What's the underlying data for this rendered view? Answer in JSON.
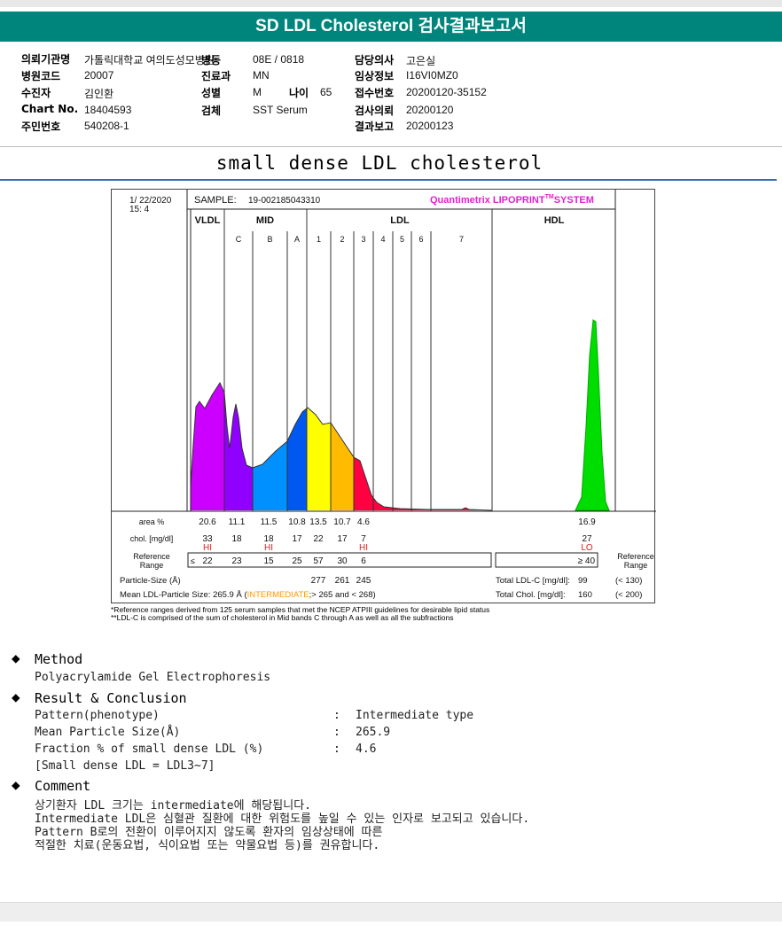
{
  "title": "SD LDL Cholesterol 검사결과보고서",
  "info": [
    {
      "label": "의뢰기관명",
      "value": "가톨릭대학교 여의도성모병원"
    },
    {
      "label": "병동",
      "value": "08E / 0818"
    },
    {
      "label": "담당의사",
      "value": "고은실"
    },
    {
      "label": "병원코드",
      "value": "20007"
    },
    {
      "label": "진료과",
      "value": "MN"
    },
    {
      "label": "임상정보",
      "value": "I16VI0MZ0"
    },
    {
      "label": "수진자",
      "value": "김인환"
    },
    {
      "label": "성별",
      "value": "M"
    },
    {
      "label": "나이",
      "value": "65"
    },
    {
      "label": "접수번호",
      "value": "20200120-35152"
    },
    {
      "label": "Chart No.",
      "value": "18404593"
    },
    {
      "label": "검체",
      "value": "SST Serum"
    },
    {
      "label": "검사의뢰",
      "value": "20200120"
    },
    {
      "label": "주민번호",
      "value": "540208-1"
    },
    {
      "label": "결과보고",
      "value": "20200123"
    }
  ],
  "subtitle": "small dense LDL cholesterol",
  "report": {
    "date": "1/ 22/2020",
    "time": "15: 4",
    "sample_label": "SAMPLE:",
    "sample": "19-002185043310",
    "brand": "Quantimetrix LIPOPRINT",
    "brand_tm": "TM",
    "brand_end": "SYSTEM",
    "brand_color": "#e020d0",
    "groups": [
      "VLDL",
      "MID",
      "LDL",
      "HDL"
    ],
    "bands": [
      {
        "name": "VLDL",
        "label": "",
        "color": "#cc00ff",
        "area": "20.6",
        "chol": "33",
        "flag": "HI",
        "ref": "22",
        "size": ""
      },
      {
        "name": "C",
        "label": "C",
        "color": "#8f00ff",
        "area": "11.1",
        "chol": "18",
        "flag": "",
        "ref": "23",
        "size": ""
      },
      {
        "name": "B",
        "label": "B",
        "color": "#0090ff",
        "area": "11.5",
        "chol": "18",
        "flag": "HI",
        "ref": "15",
        "size": ""
      },
      {
        "name": "A",
        "label": "A",
        "color": "#0058f0",
        "area": "10.8",
        "chol": "17",
        "flag": "",
        "ref": "25",
        "size": ""
      },
      {
        "name": "1",
        "label": "1",
        "color": "#ffff00",
        "area": "13.5",
        "chol": "22",
        "flag": "",
        "ref": "57",
        "size": "277"
      },
      {
        "name": "2",
        "label": "2",
        "color": "#ffbb00",
        "area": "10.7",
        "chol": "17",
        "flag": "",
        "ref": "30",
        "size": "261"
      },
      {
        "name": "3",
        "label": "3",
        "color": "#ff0040",
        "area": "4.6",
        "chol": "7",
        "flag": "HI",
        "ref": "6",
        "size": "245"
      },
      {
        "name": "4",
        "label": "4",
        "color": "#ff0040",
        "area": "",
        "chol": "",
        "flag": "",
        "ref": "",
        "size": ""
      },
      {
        "name": "5",
        "label": "5",
        "color": "#ff0040",
        "area": "",
        "chol": "",
        "flag": "",
        "ref": "",
        "size": ""
      },
      {
        "name": "6",
        "label": "6",
        "color": "#ff0040",
        "area": "",
        "chol": "",
        "flag": "",
        "ref": "",
        "size": ""
      },
      {
        "name": "7",
        "label": "7",
        "color": "#ff0040",
        "area": "",
        "chol": "",
        "flag": "",
        "ref": "",
        "size": ""
      }
    ],
    "hdl": {
      "color": "#00dd00",
      "area": "16.9",
      "chol": "27",
      "flag": "LO",
      "ref": "≥ 40"
    },
    "flag_color": "#e02020",
    "row_area": "area %",
    "row_chol": "chol. [mg/dl]",
    "row_ref": [
      "Reference",
      "Range"
    ],
    "ref_prefix": "≤",
    "row_size": "Particle-Size (Å)",
    "mean_label": "Mean LDL-Particle Size:",
    "mean_value": "265.9 Å",
    "mean_open": "(",
    "mean_class": "INTERMEDIATE",
    "mean_rest": ";> 265 and < 268)",
    "mean_class_color": "#ff9900",
    "total_ldl_label": "Total LDL-C [mg/dl]:",
    "total_ldl": "99",
    "total_ldl_ref": "(< 130)",
    "total_chol_label": "Total Chol. [mg/dl]:",
    "total_chol": "160",
    "total_chol_ref": "(< 200)",
    "note1": "*Reference ranges derived from 125 serum samples that met the NCEP ATPIII guidelines for desirable lipid status",
    "note2": "**LDL-C is comprised of the sum of cholesterol in Mid bands C through A as well as all the subfractions"
  },
  "method": {
    "heading": "Method",
    "text": "Polyacrylamide Gel Electrophoresis"
  },
  "result": {
    "heading": "Result & Conclusion",
    "rows": [
      {
        "label": "Pattern(phenotype)",
        "value": "Intermediate type"
      },
      {
        "label": "Mean Particle Size(Å)",
        "value": "265.9"
      },
      {
        "label": "Fraction % of small dense LDL (%)",
        "value": "4.6"
      }
    ],
    "sep": ":",
    "note": "[Small dense LDL = LDL3~7]"
  },
  "comment": {
    "heading": "Comment",
    "lines": [
      "상기환자 LDL 크기는 intermediate에 해당됩니다.",
      "Intermediate LDL은 심혈관 질환에 대한 위험도를 높일 수 있는 인자로 보고되고 있습니다.",
      "Pattern B로의 전환이 이루어지지 않도록 환자의 임상상태에 따른",
      "적절한 치료(운동요법, 식이요법 또는 약물요법 등)를 권유합니다."
    ]
  },
  "bullet_icon": "diamond"
}
